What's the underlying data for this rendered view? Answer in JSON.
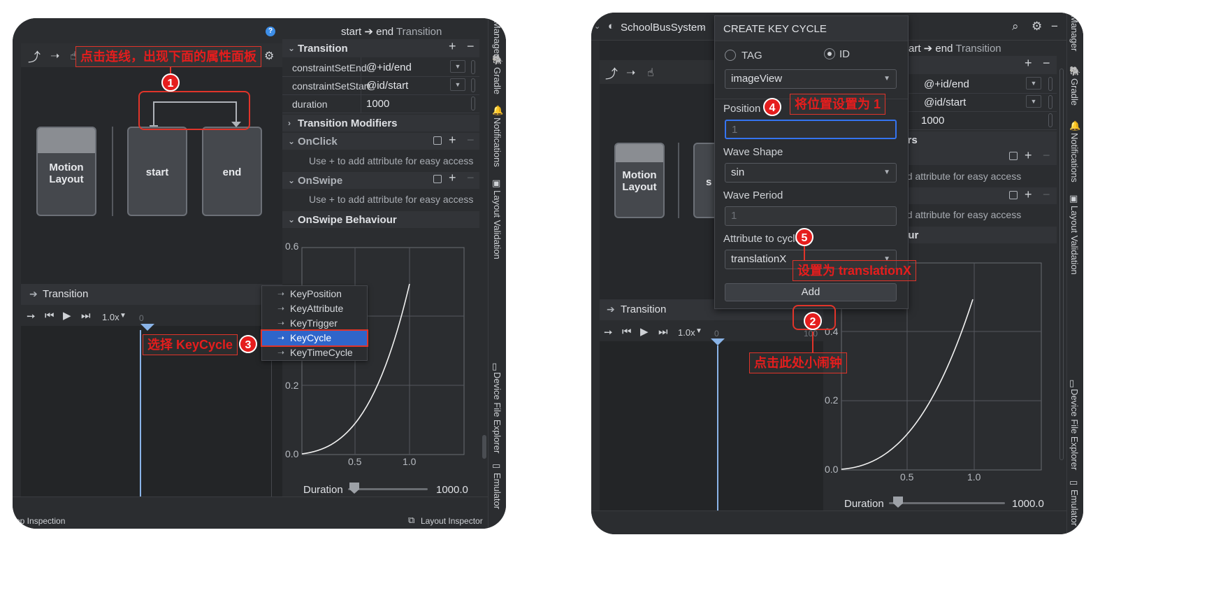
{
  "left": {
    "transition_title_parts": {
      "start": "start",
      "arrow": "➔",
      "end": "end",
      "tail": "Transition"
    },
    "help_icon": "?",
    "transition_section": "Transition",
    "attributes": [
      {
        "key": "constraintSetEnd",
        "value": "@+id/end"
      },
      {
        "key": "constraintSetStart",
        "value": "@id/start"
      },
      {
        "key": "duration",
        "value": "1000"
      }
    ],
    "modifiers_section": "Transition Modifiers",
    "onclick_section": "OnClick",
    "onclick_hint": "Use + to add attribute for easy access",
    "onswipe_section": "OnSwipe",
    "onswipe_hint": "Use + to add attribute for easy access",
    "onswipe_behaviour_section": "OnSwipe Behaviour",
    "nodes": {
      "motion_layout": "Motion Layout",
      "start": "start",
      "end": "end"
    },
    "timeline_title": "Transition",
    "speed": "1.0x",
    "timeline_zero": "0",
    "menu_items": [
      "KeyPosition",
      "KeyAttribute",
      "KeyTrigger",
      "KeyCycle",
      "KeyTimeCycle"
    ],
    "menu_selected": "KeyCycle",
    "chart_y_ticks": [
      "0.6",
      "0.2",
      "0.0"
    ],
    "chart_x_ticks": [
      "0.5",
      "1.0"
    ],
    "duration_label": "Duration",
    "duration_value": "1000.0",
    "bottom_left": "pp Inspection",
    "bottom_right": "Layout Inspector",
    "side_tabs": [
      "Manager",
      "Gradle",
      "Notifications",
      "Layout Validation",
      "Device File Explorer",
      "Emulator"
    ],
    "anno1": "点击连线，出现下面的属性面板",
    "anno3": "选择 KeyCycle",
    "badge1": "1",
    "badge3": "3"
  },
  "right": {
    "project": "SchoolBusSystem",
    "title_partial": "art ➔ end",
    "title_tail": "Transition",
    "attr_values": [
      "@+id/end",
      "@id/start",
      "1000"
    ],
    "partial_modifiers": "iers",
    "partial_hint1": "dd attribute for easy access",
    "partial_hint2": "dd attribute for easy access",
    "partial_behaviour": "iour",
    "nodes": {
      "motion_layout": "Motion Layout",
      "s": "s"
    },
    "timeline_title": "Transition",
    "speed": "1.0x",
    "timeline_zero": "0",
    "timeline_100": "100",
    "chart_y_ticks": [
      "0.4",
      "0.2",
      "0.0"
    ],
    "chart_x_ticks": [
      "0.5",
      "1.0"
    ],
    "duration_label": "Duration",
    "duration_value": "1000.0",
    "side_tabs": [
      "Manager",
      "Gradle",
      "Notifications",
      "Layout Validation",
      "Device File Explorer",
      "Emulator"
    ],
    "dialog": {
      "title": "CREATE KEY CYCLE",
      "radio_tag": "TAG",
      "radio_id": "ID",
      "id_value": "imageView",
      "position_label": "Position",
      "position_placeholder": "1",
      "wave_shape_label": "Wave Shape",
      "wave_shape_value": "sin",
      "wave_period_label": "Wave Period",
      "wave_period_placeholder": "1",
      "attr_cycle_label": "Attribute to cycle",
      "attr_cycle_value": "translationX",
      "add_button": "Add"
    },
    "anno2": "点击此处小闹钟",
    "anno4": "将位置设置为 1",
    "anno5": "设置为 translationX",
    "badge2": "2",
    "badge4": "4",
    "badge5": "5"
  },
  "colors": {
    "panel": "#2b2d30",
    "annotation": "#e51d1d",
    "selection": "#2f65ca"
  }
}
